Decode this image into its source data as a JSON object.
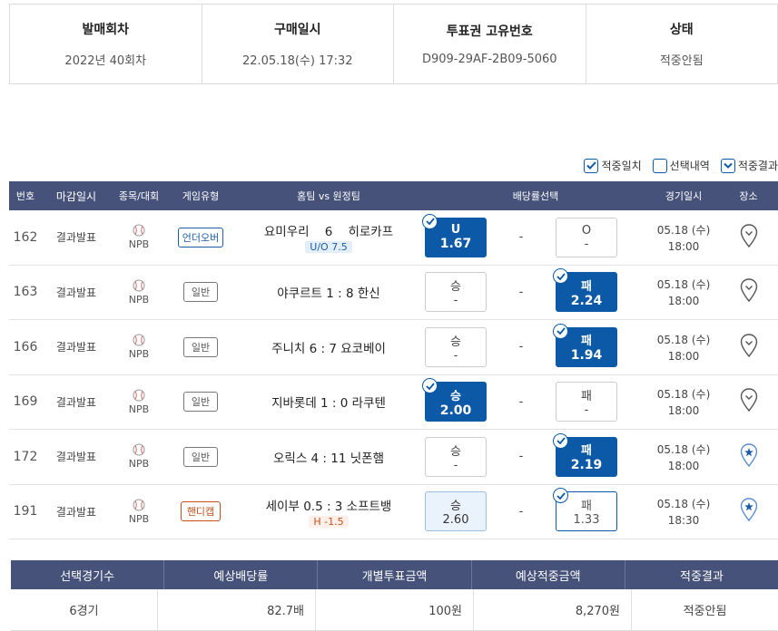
{
  "summary": [
    {
      "label": "발매회차",
      "value": "2022년 40회차"
    },
    {
      "label": "구매일시",
      "value": "22.05.18(수) 17:32"
    },
    {
      "label": "투표권 고유번호",
      "value": "D909-29AF-2B09-5060"
    },
    {
      "label": "상태",
      "value": "적중안됨"
    }
  ],
  "legend": [
    {
      "label": "적중일치",
      "checked": true
    },
    {
      "label": "선택내역",
      "checked": false
    },
    {
      "label": "적중결과",
      "checked": true
    }
  ],
  "columns": [
    "번호",
    "마감일시",
    "종목/대회",
    "게임유형",
    "홈팀 vs 원정팀",
    "배당률선택",
    "경기일시",
    "장소"
  ],
  "rows": [
    {
      "num": "162",
      "close": "결과발표",
      "league": "NPB",
      "type": "언더오버",
      "teams": "요미우리    6    히로카프",
      "sub": "U/O 7.5",
      "left": {
        "t": "U",
        "v": "1.67"
      },
      "mid": "-",
      "right": {
        "t": "O",
        "v": "-"
      },
      "date": "05.18 (수)",
      "time": "18:00"
    },
    {
      "num": "163",
      "close": "결과발표",
      "league": "NPB",
      "type": "일반",
      "teams": "야쿠르트 1 : 8 한신",
      "sub": "",
      "left": {
        "t": "승",
        "v": "-"
      },
      "mid": "-",
      "right": {
        "t": "패",
        "v": "2.24"
      },
      "date": "05.18 (수)",
      "time": "18:00"
    },
    {
      "num": "166",
      "close": "결과발표",
      "league": "NPB",
      "type": "일반",
      "teams": "주니치 6 : 7 요코베이",
      "sub": "",
      "left": {
        "t": "승",
        "v": "-"
      },
      "mid": "-",
      "right": {
        "t": "패",
        "v": "1.94"
      },
      "date": "05.18 (수)",
      "time": "18:00"
    },
    {
      "num": "169",
      "close": "결과발표",
      "league": "NPB",
      "type": "일반",
      "teams": "지바롯데 1 : 0 라쿠텐",
      "sub": "",
      "left": {
        "t": "승",
        "v": "2.00"
      },
      "mid": "-",
      "right": {
        "t": "패",
        "v": "-"
      },
      "date": "05.18 (수)",
      "time": "18:00"
    },
    {
      "num": "172",
      "close": "결과발표",
      "league": "NPB",
      "type": "일반",
      "teams": "오릭스 4 : 11 닛폰햄",
      "sub": "",
      "left": {
        "t": "승",
        "v": "-"
      },
      "mid": "-",
      "right": {
        "t": "패",
        "v": "2.19"
      },
      "date": "05.18 (수)",
      "time": "18:00"
    },
    {
      "num": "191",
      "close": "결과발표",
      "league": "NPB",
      "type": "핸디캡",
      "teams": "세이부 0.5 : 3 소프트뱅",
      "sub": "H -1.5",
      "left": {
        "t": "승",
        "v": "2.60"
      },
      "mid": "-",
      "right": {
        "t": "패",
        "v": "1.33"
      },
      "date": "05.18 (수)",
      "time": "18:30"
    }
  ],
  "bottom": {
    "headers": [
      "선택경기수",
      "예상배당률",
      "개별투표금액",
      "예상적중금액",
      "적중결과"
    ],
    "values": [
      "6경기",
      "82.7배",
      "100원",
      "8,270원",
      "적중안됨"
    ]
  },
  "colors": {
    "header_bg": "#46527a",
    "selected": "#0c5aa7",
    "handicap": "#c74f1b"
  }
}
